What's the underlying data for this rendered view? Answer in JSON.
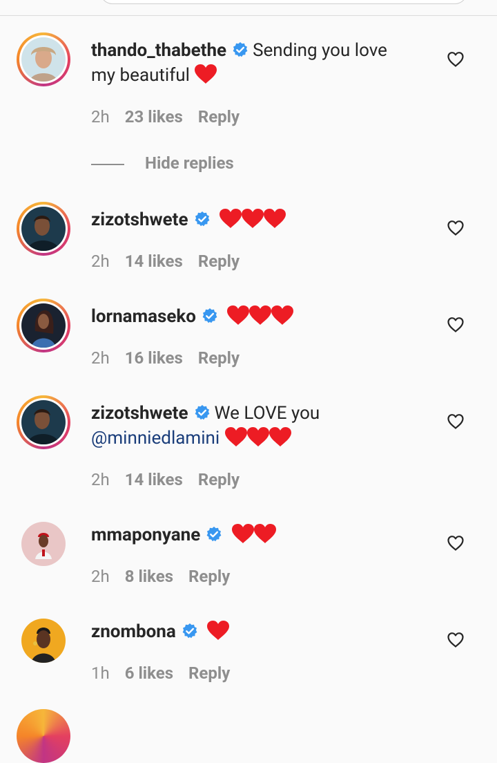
{
  "colors": {
    "text": "#262626",
    "muted": "#8e8e8e",
    "heart": "#ed1c24",
    "verified": "#3897f0",
    "mention": "#1a3d7a"
  },
  "hide_replies_label": "Hide replies",
  "comments": [
    {
      "username": "thando_thabethe",
      "text": "Sending you love my beautiful",
      "hearts": 1,
      "time": "2h",
      "likes": "23 likes",
      "reply": "Reply"
    },
    {
      "username": "zizotshwete",
      "text": "",
      "hearts": 3,
      "time": "2h",
      "likes": "14 likes",
      "reply": "Reply"
    },
    {
      "username": "lornamaseko",
      "text": "",
      "hearts": 3,
      "time": "2h",
      "likes": "16 likes",
      "reply": "Reply"
    },
    {
      "username": "zizotshwete",
      "text": "We LOVE you",
      "mention": "@minniedlamini",
      "hearts": 3,
      "time": "2h",
      "likes": "14 likes",
      "reply": "Reply"
    },
    {
      "username": "mmaponyane",
      "text": "",
      "hearts": 2,
      "time": "2h",
      "likes": "8 likes",
      "reply": "Reply"
    },
    {
      "username": "znombona",
      "text": "",
      "hearts": 1,
      "time": "1h",
      "likes": "6 likes",
      "reply": "Reply"
    }
  ]
}
